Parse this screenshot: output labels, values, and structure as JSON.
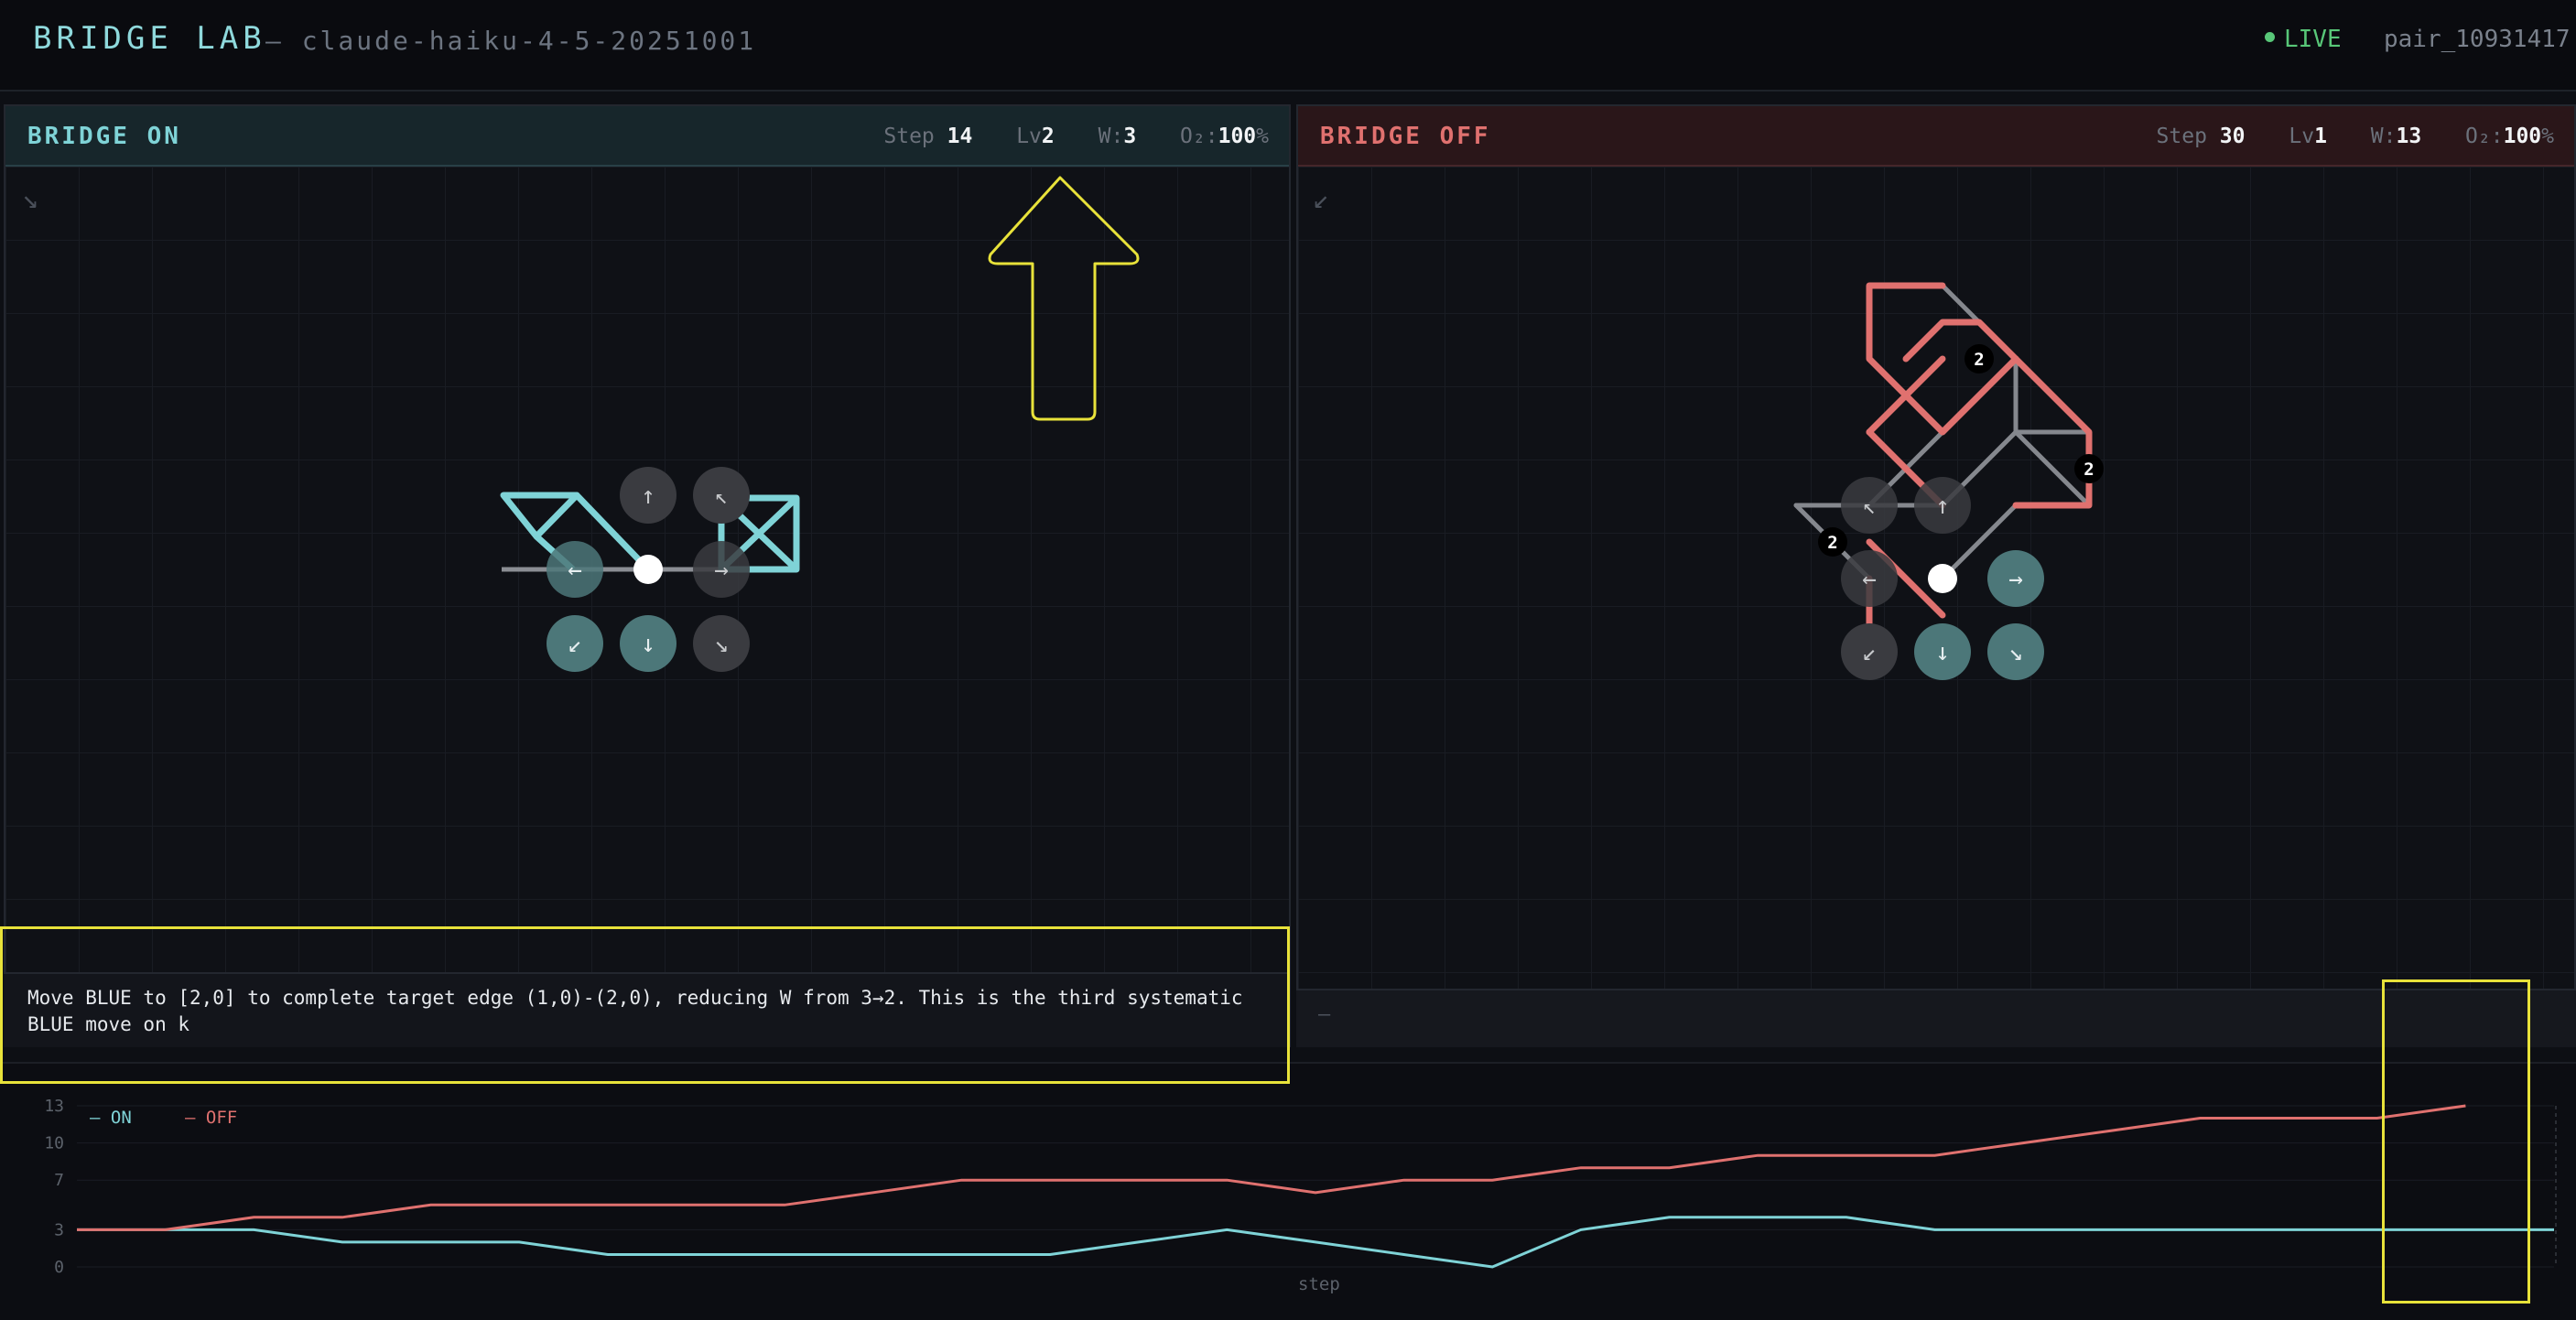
{
  "header": {
    "brand": "BRIDGE LAB",
    "model": "— claude-haiku-4-5-20251001",
    "live": "LIVE",
    "pair_id": "pair_10931417"
  },
  "panels": {
    "on": {
      "title": "BRIDGE ON",
      "step_label": "Step",
      "step": "14",
      "lv_label": "Lv",
      "lv": "2",
      "w_label": "W:",
      "w": "3",
      "o2_label": "O₂:",
      "o2": "100",
      "o2_unit": "%",
      "corner_icon": "arrow-down-right",
      "message": "Move BLUE to [2,0] to complete target edge (1,0)-(2,0), reducing W from 3→2. This is the third systematic BLUE move on k",
      "dpad": [
        "↑",
        "↖",
        "←",
        "→",
        "↙",
        "↓",
        "↘"
      ],
      "accent": "#7fd3d7"
    },
    "off": {
      "title": "BRIDGE OFF",
      "step_label": "Step",
      "step": "30",
      "lv_label": "Lv",
      "lv": "1",
      "w_label": "W:",
      "w": "13",
      "o2_label": "O₂:",
      "o2": "100",
      "o2_unit": "%",
      "corner_icon": "arrow-down-left",
      "message": "—",
      "dpad": [
        "↖",
        "↑",
        "←",
        "→",
        "↙",
        "↓",
        "↘"
      ],
      "badges": [
        "2",
        "2",
        "2"
      ],
      "accent": "#e0716f"
    }
  },
  "chart_data": {
    "type": "line",
    "xlabel": "step",
    "ylabel": "",
    "yticks": [
      "13",
      "10",
      "7",
      "3",
      "0"
    ],
    "ylim": [
      0,
      13
    ],
    "legend": "top-left",
    "series": [
      {
        "name": "ON",
        "color": "#7fd3d7",
        "values": [
          3,
          3,
          3,
          2,
          2,
          2,
          1,
          1,
          1,
          1,
          1,
          1,
          2,
          3,
          2,
          1,
          0,
          3,
          4,
          4,
          4,
          3,
          3,
          3,
          3,
          3,
          3,
          3,
          3
        ]
      },
      {
        "name": "OFF",
        "color": "#e0716f",
        "values": [
          3,
          3,
          4,
          4,
          5,
          5,
          5,
          5,
          5,
          6,
          7,
          7,
          7,
          7,
          6,
          7,
          7,
          8,
          8,
          9,
          9,
          9,
          10,
          11,
          12,
          12,
          12,
          13
        ]
      }
    ]
  }
}
